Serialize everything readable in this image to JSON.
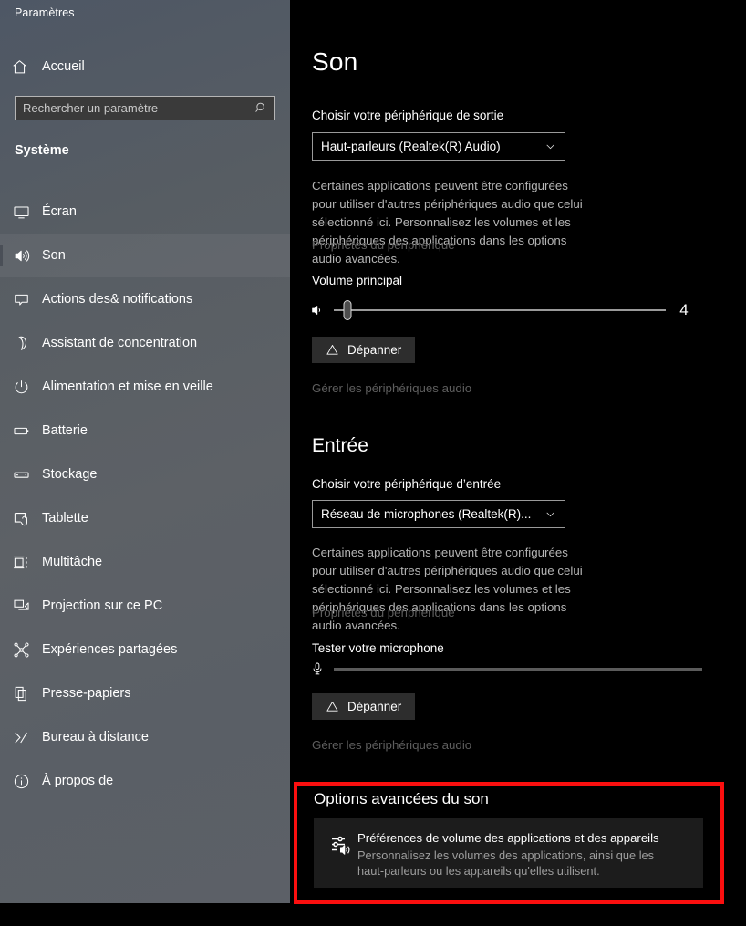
{
  "window": {
    "title": "Paramètres"
  },
  "sidebar": {
    "home_label": "Accueil",
    "home_icon": "home-icon",
    "search": {
      "placeholder": "Rechercher un paramètre",
      "value": "",
      "icon": "search-icon"
    },
    "section_label": "Système",
    "items": [
      {
        "label": "Écran",
        "icon": "monitor-icon",
        "selected": false
      },
      {
        "label": "Son",
        "icon": "speaker-icon",
        "selected": true
      },
      {
        "label": "Actions des& notifications",
        "icon": "notification-icon",
        "selected": false
      },
      {
        "label": "Assistant de concentration",
        "icon": "moon-icon",
        "selected": false
      },
      {
        "label": "Alimentation et mise en veille",
        "icon": "power-icon",
        "selected": false
      },
      {
        "label": "Batterie",
        "icon": "battery-icon",
        "selected": false
      },
      {
        "label": "Stockage",
        "icon": "storage-icon",
        "selected": false
      },
      {
        "label": "Tablette",
        "icon": "tablet-icon",
        "selected": false
      },
      {
        "label": "Multitâche",
        "icon": "multitask-icon",
        "selected": false
      },
      {
        "label": "Projection sur ce PC",
        "icon": "projection-icon",
        "selected": false
      },
      {
        "label": "Expériences partagées",
        "icon": "shared-experiences-icon",
        "selected": false
      },
      {
        "label": "Presse-papiers",
        "icon": "clipboard-icon",
        "selected": false
      },
      {
        "label": "Bureau à distance",
        "icon": "remote-desktop-icon",
        "selected": false
      },
      {
        "label": "À propos de",
        "icon": "info-icon",
        "selected": false
      }
    ]
  },
  "main": {
    "page_title": "Son",
    "output": {
      "device_label": "Choisir votre périphérique de sortie",
      "device_value": "Haut-parleurs (Realtek(R) Audio)",
      "description": "Certaines applications peuvent être configurées pour utiliser d'autres périphériques audio que celui sélectionné ici. Personnalisez les volumes et les périphériques des applications dans les options audio avancées.",
      "device_properties_link": "Propriétés du périphérique",
      "volume_label": "Volume principal",
      "volume_value": "4",
      "volume_percent": 4,
      "troubleshoot_label": "Dépanner",
      "manage_devices_link": "Gérer les périphériques audio"
    },
    "input": {
      "section_title": "Entrée",
      "device_label": "Choisir votre périphérique d’entrée",
      "device_value": "Réseau de microphones (Realtek(R)...",
      "description": "Certaines applications peuvent être configurées pour utiliser d'autres périphériques audio que celui sélectionné ici. Personnalisez les volumes et les périphériques des applications dans les options audio avancées.",
      "device_properties_link": "Propriétés du périphérique",
      "test_label": "Tester votre microphone",
      "test_level_percent": 0,
      "troubleshoot_label": "Dépanner",
      "manage_devices_link": "Gérer les périphériques audio"
    },
    "advanced": {
      "section_title": "Options avancées du son",
      "card_icon": "volume-mixer-icon",
      "card_title": "Préférences de volume des applications et des appareils",
      "card_subtitle": "Personnalisez les volumes des applications, ainsi que les haut-parleurs ou les appareils qu'elles utilisent."
    }
  },
  "colors": {
    "highlight_border": "#fb0f0f",
    "background": "#000000",
    "sidebar_gradient_start": "#4e5765",
    "sidebar_gradient_end": "#5c6067",
    "card_background": "#1c1c1c",
    "button_background": "#2d2d2d"
  }
}
